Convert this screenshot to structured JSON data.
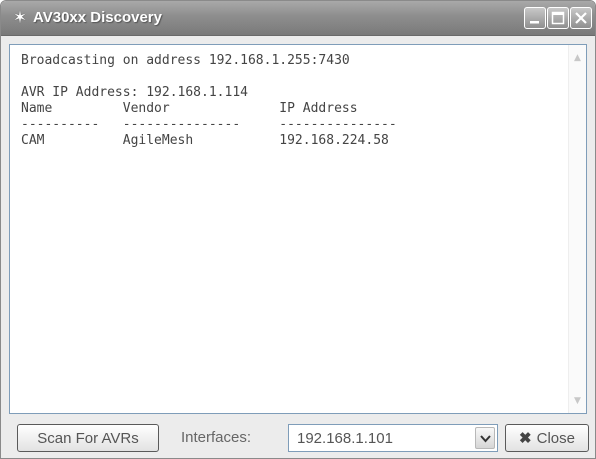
{
  "window": {
    "title": "AV30xx Discovery",
    "icon": "star-icon"
  },
  "output": {
    "lines": [
      "Broadcasting on address 192.168.1.255:7430",
      "",
      "AVR IP Address: 192.168.1.114",
      "Name         Vendor              IP Address",
      "----------   ---------------     ---------------",
      "CAM          AgileMesh           192.168.224.58"
    ]
  },
  "bottom": {
    "scan_label": "Scan For AVRs",
    "interfaces_label": "Interfaces:",
    "interface_selected": "192.168.1.101",
    "close_label": "Close"
  },
  "colors": {
    "titlebar": "#8d8d8d",
    "window_bg": "#ececec",
    "output_border": "#7f9db9"
  }
}
